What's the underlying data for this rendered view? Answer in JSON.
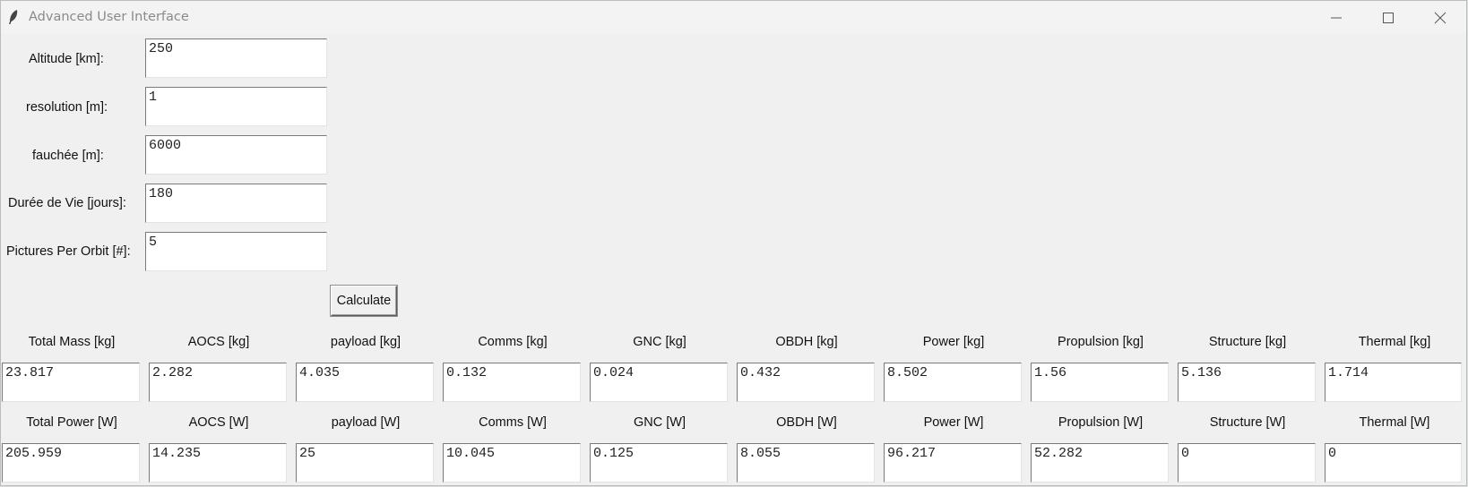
{
  "window": {
    "title": "Advanced User Interface"
  },
  "inputs": [
    {
      "label": "Altitude [km]:",
      "value": "250"
    },
    {
      "label": "resolution [m]:",
      "value": "1"
    },
    {
      "label": "fauchée [m]:",
      "value": "6000"
    },
    {
      "label": "Durée de Vie [jours]:",
      "value": "180"
    },
    {
      "label": "Pictures Per Orbit [#]:",
      "value": "5"
    }
  ],
  "calculate_label": "Calculate",
  "mass": {
    "labels": [
      "Total Mass [kg]",
      "AOCS [kg]",
      "payload [kg]",
      "Comms [kg]",
      "GNC [kg]",
      "OBDH [kg]",
      "Power [kg]",
      "Propulsion [kg]",
      "Structure [kg]",
      "Thermal [kg]"
    ],
    "values": [
      "23.817",
      "2.282",
      "4.035",
      "0.132",
      "0.024",
      "0.432",
      "8.502",
      "1.56",
      "5.136",
      "1.714"
    ]
  },
  "power": {
    "labels": [
      "Total Power [W]",
      "AOCS [W]",
      "payload [W]",
      "Comms [W]",
      "GNC [W]",
      "OBDH [W]",
      "Power [W]",
      "Propulsion [W]",
      "Structure [W]",
      "Thermal [W]"
    ],
    "values": [
      "205.959",
      "14.235",
      "25",
      "10.045",
      "0.125",
      "8.055",
      "96.217",
      "52.282",
      "0",
      "0"
    ]
  },
  "icons": {
    "app": "feather-icon",
    "minimize": "minimize-icon",
    "maximize": "maximize-icon",
    "close": "close-icon"
  }
}
